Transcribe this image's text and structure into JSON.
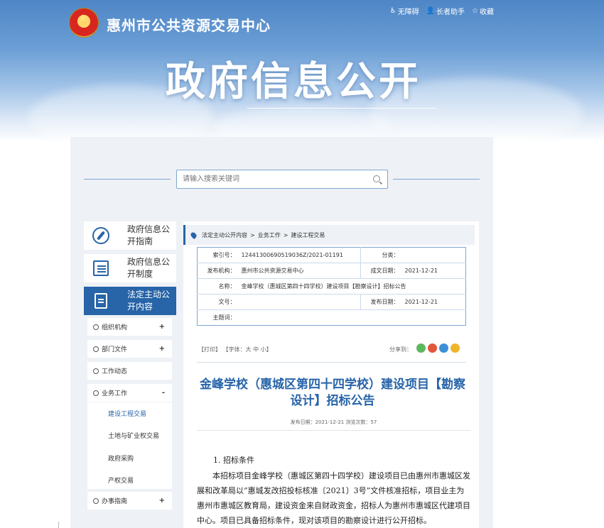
{
  "header": {
    "site_name": "惠州市公共资源交易中心",
    "links": [
      "无障碍",
      "长者助手",
      "收藏"
    ],
    "big_title": "政府信息公开"
  },
  "search": {
    "placeholder": "请输入搜索关键词"
  },
  "nav_cards": [
    {
      "label": "政府信息公开指南"
    },
    {
      "label": "政府信息公开制度"
    },
    {
      "label": "法定主动公开内容"
    }
  ],
  "menu": [
    {
      "label": "组织机构",
      "toggle": "+"
    },
    {
      "label": "部门文件",
      "toggle": "+"
    },
    {
      "label": "工作动态",
      "toggle": ""
    },
    {
      "label": "业务工作",
      "toggle": "-"
    },
    {
      "label": "办事指南",
      "toggle": "+"
    }
  ],
  "submenu": [
    "建设工程交易",
    "土地与矿业权交易",
    "政府采购",
    "产权交易"
  ],
  "breadcrumb": [
    "法定主动公开内容",
    ">",
    "业务工作",
    ">",
    "建设工程交易"
  ],
  "meta": {
    "index_label": "索引号：",
    "index_value": "12441300690519036Z/2021-01191",
    "category_label": "分类：",
    "category_value": "",
    "org_label": "发布机构：",
    "org_value": "惠州市公共资源交易中心",
    "created_label": "成文日期：",
    "created_value": "2021-12-21",
    "name_label": "名称：",
    "name_value": "金峰学校（惠城区第四十四学校）建设项目【勘察设计】招标公告",
    "docno_label": "文号：",
    "docno_value": "",
    "published_label": "发布日期：",
    "published_value": "2021-12-21",
    "subject_label": "主题词：",
    "subject_value": ""
  },
  "tools": {
    "print": "【打印】",
    "font": "【字体：大 中 小】",
    "share": "分享到："
  },
  "article": {
    "title": "金峰学校（惠城区第四十四学校）建设项目【勘察设计】招标公告",
    "date_line": "发布日期：2021-12-21  浏览次数：57",
    "section1": "1. 招标条件",
    "para1": "本招标项目金峰学校（惠城区第四十四学校）建设项目已由惠州市惠城区发展和改革局以“惠城发改招投标核准〔2021〕3号”文件核准招标，项目业主为惠州市惠城区教育局，建设资金来自财政资金，招标人为惠州市惠城区代建项目中心。项目已具备招标条件，现对该项目的勘察设计进行公开招标。"
  },
  "colors": {
    "accent": "#2764a8",
    "panel": "#eef1f5"
  }
}
